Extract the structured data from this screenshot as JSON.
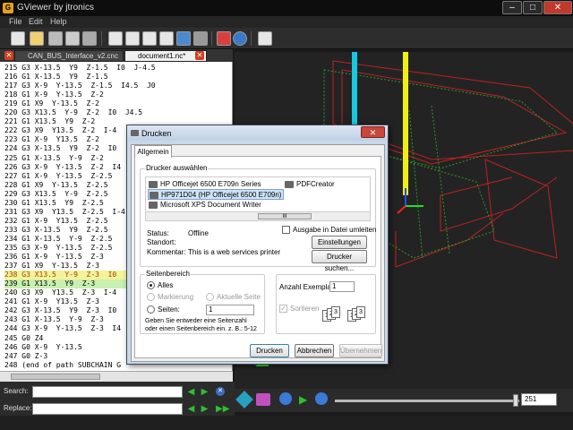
{
  "app": {
    "title": "GViewer by jtronics",
    "menu": [
      "File",
      "Edit",
      "Help"
    ],
    "window_controls": {
      "minimize": "–",
      "maximize": "□",
      "close": "✕"
    }
  },
  "tabs": [
    {
      "label": "CAN_BUS_Interface_v2.cnc",
      "active": false,
      "close": "✕"
    },
    {
      "label": "document1.nc*",
      "active": true,
      "close": "✕"
    }
  ],
  "editor": {
    "lines": [
      "215 G3 X-13.5  Y9  Z-1.5  I0  J-4.5",
      "216 G1 X-13.5  Y9  Z-1.5",
      "217 G3 X-9  Y-13.5  Z-1.5  I4.5  J0",
      "218 G1 X-9  Y-13.5  Z-2",
      "219 G1 X9  Y-13.5  Z-2",
      "220 G3 X13.5  Y-9  Z-2  I0  J4.5",
      "221 G1 X13.5  Y9  Z-2",
      "222 G3 X9  Y13.5  Z-2  I-4",
      "223 G1 X-9  Y13.5  Z-2",
      "224 G3 X-13.5  Y9  Z-2  I0",
      "225 G1 X-13.5  Y-9  Z-2",
      "226 G3 X-9  Y-13.5  Z-2  I4",
      "227 G1 X-9  Y-13.5  Z-2.5",
      "228 G1 X9  Y-13.5  Z-2.5",
      "229 G3 X13.5  Y-9  Z-2.5",
      "230 G1 X13.5  Y9  Z-2.5",
      "231 G3 X9  Y13.5  Z-2.5  I-4",
      "232 G1 X-9  Y13.5  Z-2.5",
      "233 G3 X-13.5  Y9  Z-2.5",
      "234 G1 X-13.5  Y-9  Z-2.5",
      "235 G3 X-9  Y-13.5  Z-2.5",
      "236 G1 X-9  Y-13.5  Z-3",
      "237 G1 X9  Y-13.5  Z-3",
      "238 G3 X13.5  Y-9  Z-3  I0",
      "239 G1 X13.5  Y9  Z-3",
      "240 G3 X9  Y13.5  Z-3  I-4",
      "241 G1 X-9  Y13.5  Z-3",
      "242 G3 X-13.5  Y9  Z-3  I0",
      "243 G1 X-13.5  Y-9  Z-3",
      "244 G3 X-9  Y-13.5  Z-3  I4",
      "245 G0 Z4",
      "246 G0 X-9  Y-13.5",
      "247 G0 Z-3",
      "248 (end of path SUBCHAIN G"
    ],
    "highlighted_line": 23
  },
  "find": {
    "search_label": "Search:",
    "replace_label": "Replace:"
  },
  "player": {
    "frame": "251"
  },
  "dialog": {
    "title": "Drucken",
    "close": "✕",
    "tab": "Allgemein",
    "printer_group_title": "Drucker auswählen",
    "printers": [
      {
        "name": "HP Officejet 6500 E709n Series",
        "selected": false
      },
      {
        "name": "PDFCreator",
        "selected": false
      },
      {
        "name": "HP971D04 (HP Officejet 6500 E709n)",
        "selected": true
      },
      {
        "name": "Microsoft XPS Document Writer",
        "selected": false
      }
    ],
    "scroll_thumb": "III",
    "status_label": "Status:",
    "status_value": "Offline",
    "location_label": "Standort:",
    "comment_label": "Kommentar:",
    "comment_value": "This is a web services printer",
    "print_to_file": "Ausgabe in Datei umleiten",
    "settings_button": "Einstellungen",
    "find_printer_button": "Drucker suchen...",
    "range_group_title": "Seitenbereich",
    "range_all": "Alles",
    "range_selection": "Markierung",
    "range_current": "Aktuelle Seite",
    "range_pages": "Seiten:",
    "pages_value": "1",
    "range_hint": "Geben Sie entweder eine Seitenzahl oder einen Seitenbereich ein. z. B.: 5-12",
    "copies_label": "Anzahl Exemplare:",
    "copies_value": "1",
    "collate_label": "Sortieren",
    "print_button": "Drucken",
    "cancel_button": "Abbrechen",
    "apply_button": "Übernehmen"
  }
}
